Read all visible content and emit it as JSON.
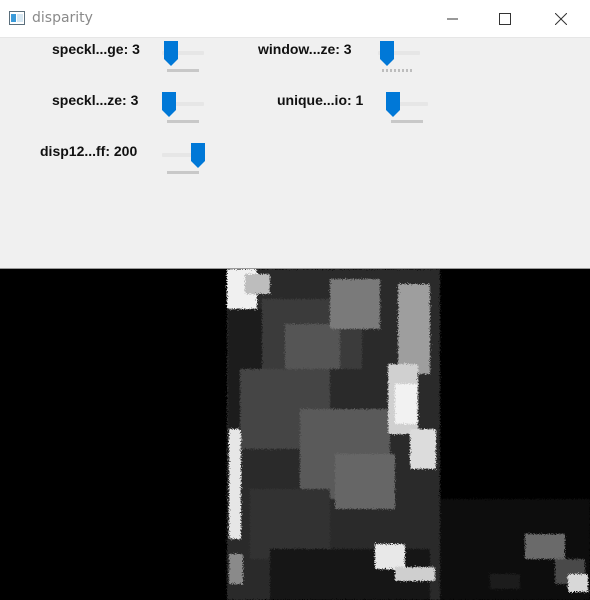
{
  "window": {
    "title": "disparity",
    "icon": "opencv-window-icon",
    "controls": [
      "minimize-icon",
      "maximize-icon",
      "close-icon"
    ]
  },
  "trackbars": [
    {
      "id": "speckle-range",
      "label": "speckl...ge: 3",
      "value": 3
    },
    {
      "id": "window-size",
      "label": "window...ze: 3",
      "value": 3
    },
    {
      "id": "speckle-window-size",
      "label": "speckl...ze: 3",
      "value": 3
    },
    {
      "id": "uniqueness-ratio",
      "label": "unique...io: 1",
      "value": 1
    },
    {
      "id": "disp12-max-diff",
      "label": "disp12...ff: 200",
      "value": 200
    }
  ],
  "colors": {
    "accent": "#0078d7",
    "panel": "#f0f0f0",
    "image_background": "#000000"
  }
}
